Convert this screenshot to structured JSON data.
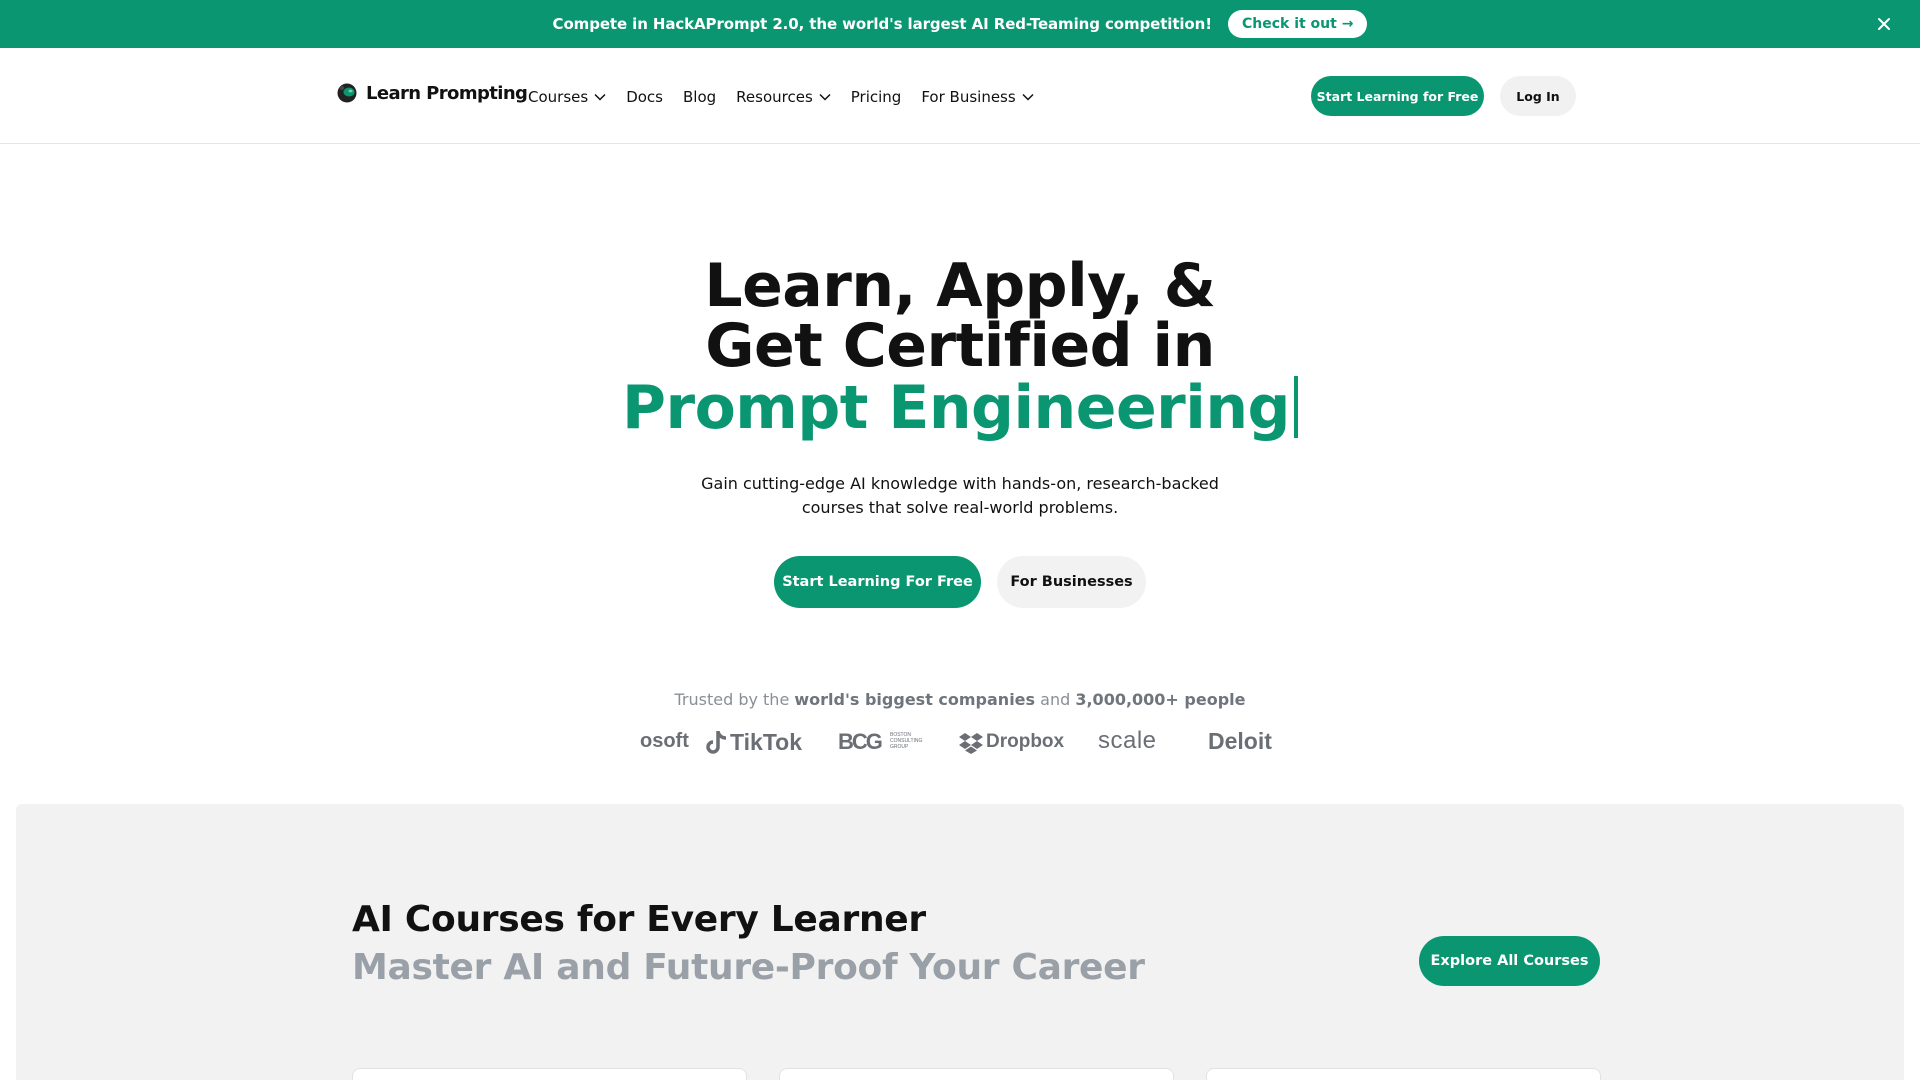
{
  "banner": {
    "text": "Compete in HackAPrompt 2.0, the world's largest AI Red-Teaming competition!",
    "cta": "Check it out →"
  },
  "header": {
    "logo_text": "Learn Prompting",
    "nav": [
      {
        "label": "Courses",
        "dropdown": true
      },
      {
        "label": "Docs",
        "dropdown": false
      },
      {
        "label": "Blog",
        "dropdown": false
      },
      {
        "label": "Resources",
        "dropdown": true
      },
      {
        "label": "Pricing",
        "dropdown": false
      },
      {
        "label": "For Business",
        "dropdown": true
      }
    ],
    "cta": "Start Learning for Free",
    "login": "Log In"
  },
  "hero": {
    "line1": "Learn, Apply, &",
    "line2": "Get Certified in",
    "line3": "Prompt Engineering",
    "subtitle_line1": "Gain cutting-edge AI knowledge with hands-on, research-backed",
    "subtitle_line2": "courses that solve real-world problems.",
    "cta_primary": "Start Learning For Free",
    "cta_secondary": "For Businesses"
  },
  "trusted": {
    "prefix": "Trusted by the ",
    "strong1": "world's biggest companies",
    "middle": " and ",
    "strong2": "3,000,000+ people"
  },
  "companies": [
    "osoft",
    "TikTok",
    "BCG",
    "Dropbox",
    "scale",
    "Deloit"
  ],
  "bcg_tagline": [
    "BOSTON",
    "CONSULTING",
    "GROUP"
  ],
  "courses_section": {
    "title": "AI Courses for Every Learner",
    "subtitle": "Master AI and Future-Proof Your Career",
    "cta": "Explore All Courses"
  },
  "colors": {
    "brand": "#0a9671",
    "muted": "#9aa0a7",
    "panel": "#f2f2f2"
  }
}
